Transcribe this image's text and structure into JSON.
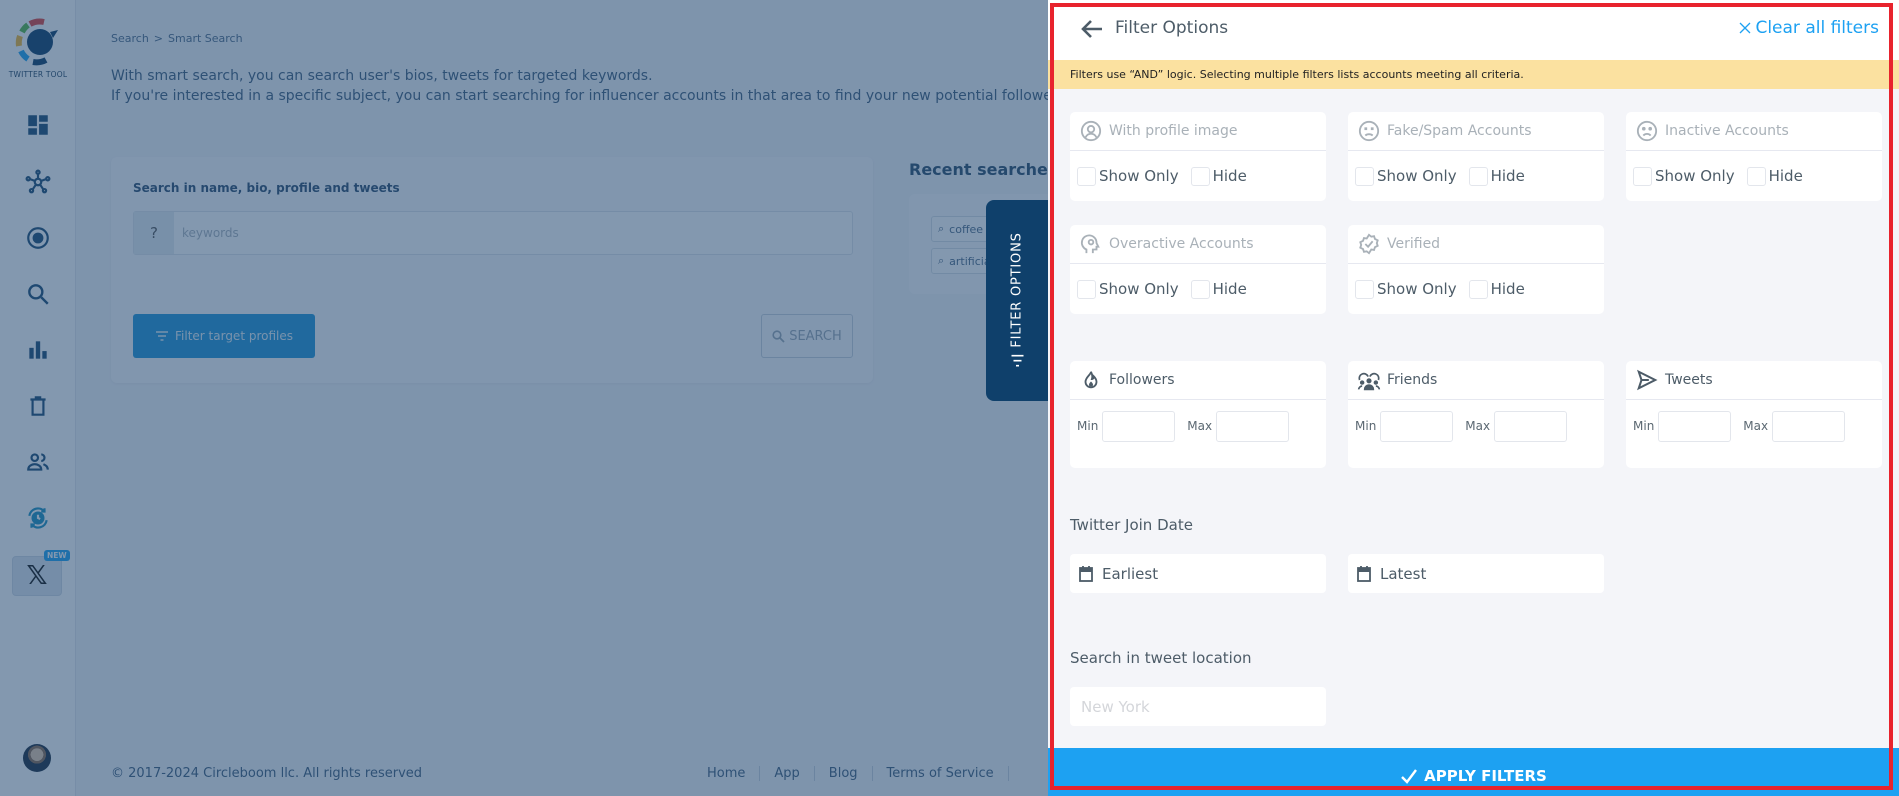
{
  "sidebar": {
    "logo_text": "TWITTER TOOL",
    "items": [
      {
        "name": "dashboard",
        "icon": "dashboard-icon"
      },
      {
        "name": "network",
        "icon": "network-icon"
      },
      {
        "name": "target",
        "icon": "target-icon"
      },
      {
        "name": "search",
        "icon": "search-icon"
      },
      {
        "name": "analytics",
        "icon": "bar-chart-icon"
      },
      {
        "name": "delete",
        "icon": "trash-icon"
      },
      {
        "name": "users",
        "icon": "users-icon"
      },
      {
        "name": "scheduler",
        "icon": "clock-sync-icon"
      }
    ],
    "x_item": {
      "label": "𝕏",
      "badge": "NEW"
    }
  },
  "breadcrumb": {
    "items": [
      "Search",
      "Smart Search"
    ],
    "separator": ">"
  },
  "intro": {
    "line1": "With smart search, you can search user's bios, tweets for targeted keywords.",
    "line2": "If you're interested in a specific subject, you can start searching for influencer accounts in that area to find your new potential followers."
  },
  "search_card": {
    "label": "Search in name, bio, profile and tweets",
    "help_icon": "?",
    "placeholder": "keywords",
    "value": "",
    "filter_button": "Filter target profiles",
    "search_button": "SEARCH"
  },
  "recent": {
    "title": "Recent searches",
    "items": [
      "coffee",
      "artificial"
    ]
  },
  "footer": {
    "copyright": "© 2017-2024 Circleboom llc. All rights reserved",
    "links": [
      "Home",
      "App",
      "Blog",
      "Terms of Service"
    ]
  },
  "filter_tab": {
    "label": "FILTER OPTIONS"
  },
  "panel": {
    "title": "Filter Options",
    "clear_all": "Clear all filters",
    "banner": "Filters use “AND” logic. Selecting multiple filters lists accounts meeting all criteria.",
    "toggle_filters": [
      {
        "title": "With profile image",
        "icon": "profile-image-icon",
        "show_only": "Show Only",
        "hide": "Hide",
        "show_only_checked": false,
        "hide_checked": false
      },
      {
        "title": "Fake/Spam Accounts",
        "icon": "fake-spam-icon",
        "show_only": "Show Only",
        "hide": "Hide",
        "show_only_checked": false,
        "hide_checked": false
      },
      {
        "title": "Inactive Accounts",
        "icon": "inactive-icon",
        "show_only": "Show Only",
        "hide": "Hide",
        "show_only_checked": false,
        "hide_checked": false
      },
      {
        "title": "Overactive Accounts",
        "icon": "overactive-icon",
        "show_only": "Show Only",
        "hide": "Hide",
        "show_only_checked": false,
        "hide_checked": false
      },
      {
        "title": "Verified",
        "icon": "verified-icon",
        "show_only": "Show Only",
        "hide": "Hide",
        "show_only_checked": false,
        "hide_checked": false
      }
    ],
    "range_filters": [
      {
        "title": "Followers",
        "icon": "fire-icon",
        "min_label": "Min",
        "max_label": "Max",
        "min": "",
        "max": ""
      },
      {
        "title": "Friends",
        "icon": "friends-icon",
        "min_label": "Min",
        "max_label": "Max",
        "min": "",
        "max": ""
      },
      {
        "title": "Tweets",
        "icon": "send-icon",
        "min_label": "Min",
        "max_label": "Max",
        "min": "",
        "max": ""
      }
    ],
    "join_date": {
      "title": "Twitter Join Date",
      "earliest": "Earliest",
      "latest": "Latest"
    },
    "location": {
      "title": "Search in tweet location",
      "placeholder": "New York",
      "value": ""
    },
    "apply": "APPLY FILTERS"
  },
  "colors": {
    "accent": "#1da1f2",
    "banner": "#fbe1a0",
    "tab": "#0f406b",
    "highlight_frame": "#e8232d"
  }
}
